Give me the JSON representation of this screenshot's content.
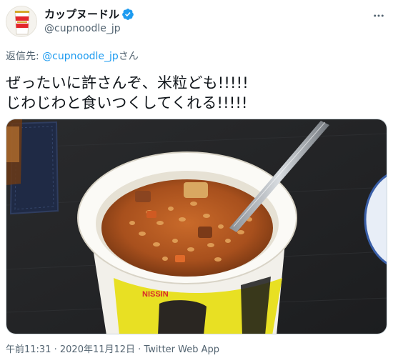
{
  "header": {
    "display_name": "カップヌードル",
    "handle": "@cupnoodle_jp",
    "avatar": "cup-noodle-logo",
    "badge": "verified-icon"
  },
  "reply": {
    "prefix": "返信先: ",
    "mention": "@cupnoodle_jp",
    "suffix": "さん"
  },
  "tweet": {
    "line1": "ぜったいに許さんぞ、米粒ども!!!!!",
    "line2": "じわじわと食いつくしてくれる!!!!!"
  },
  "meta": {
    "time": "午前11:31",
    "separator1": " · ",
    "date": "2020年11月12日",
    "separator2": " · ",
    "app": "Twitter Web App"
  },
  "colors": {
    "accent": "#1d9bf0",
    "secondary_text": "#536471"
  }
}
